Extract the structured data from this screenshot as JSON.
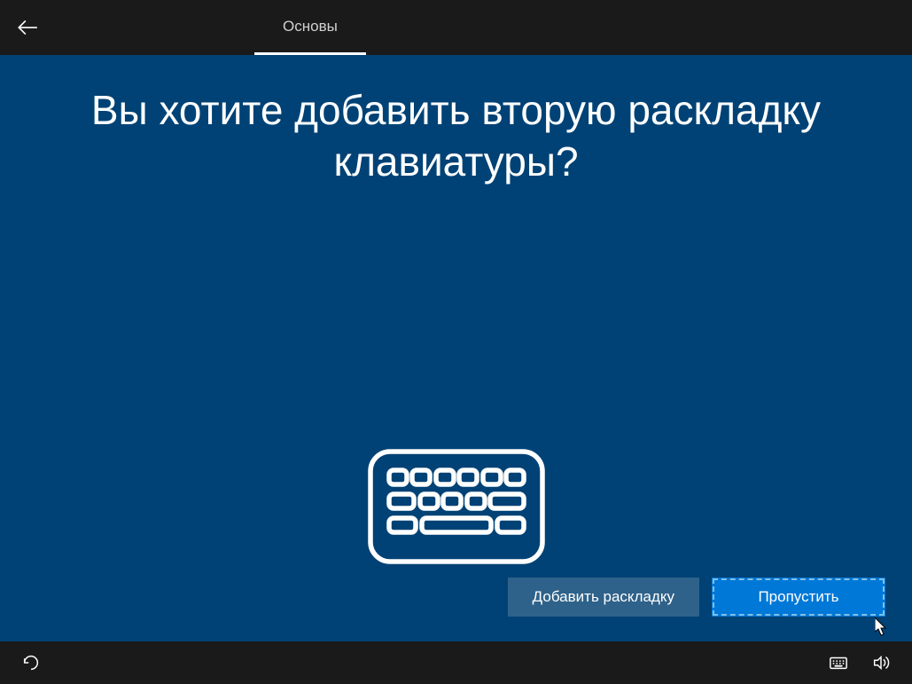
{
  "header": {
    "tab_label": "Основы"
  },
  "main": {
    "heading": "Вы хотите добавить вторую раскладку клавиатуры?"
  },
  "buttons": {
    "secondary_label": "Добавить раскладку",
    "primary_label": "Пропустить"
  }
}
